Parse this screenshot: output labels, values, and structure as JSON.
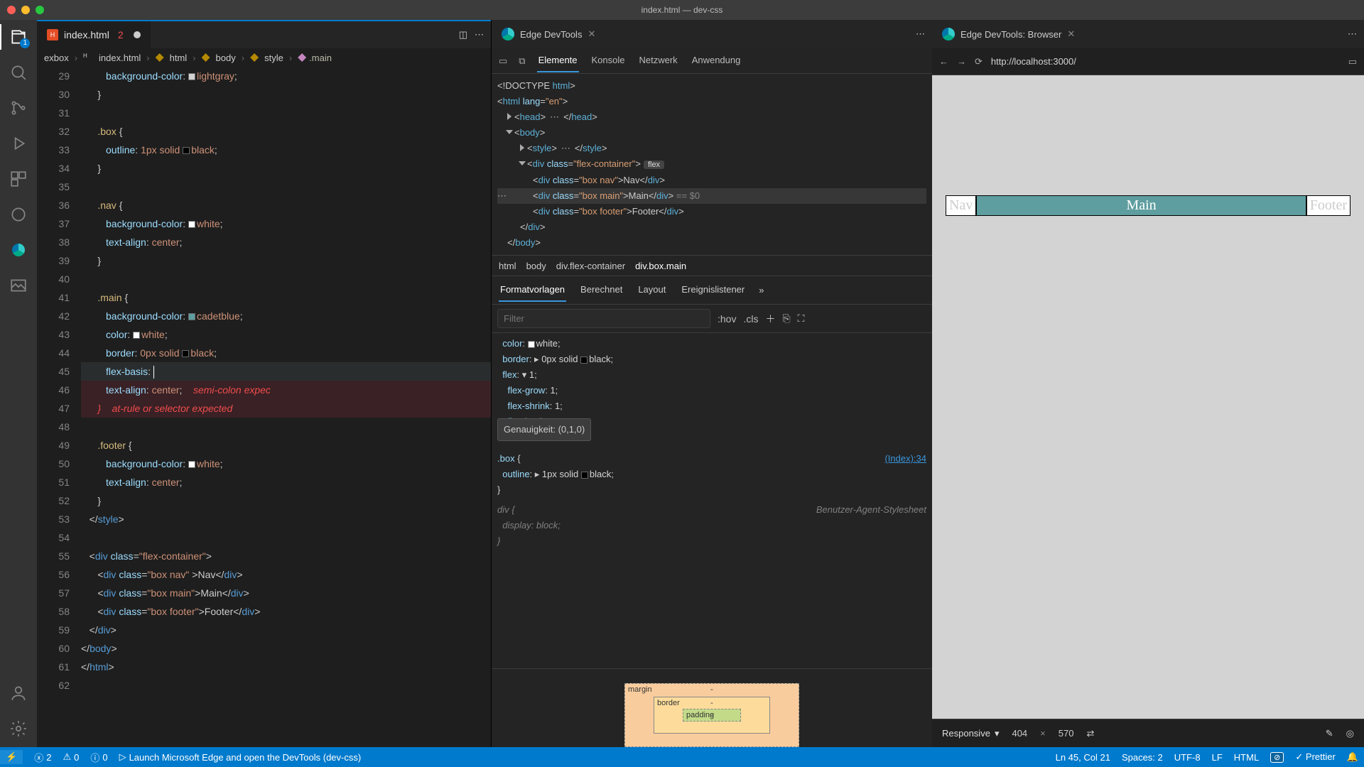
{
  "titlebar": {
    "title": "index.html — dev-css"
  },
  "activity": {
    "badge": "1"
  },
  "editor": {
    "tab": {
      "file": "index.html",
      "errors": "2"
    },
    "breadcrumb": [
      "exbox",
      "index.html",
      "html",
      "body",
      "style",
      ".main"
    ],
    "lines": [
      {
        "n": 29,
        "html": "         <span class='prop'>background-color</span>: <span class='sw' style='background:#d3d3d3'></span><span class='val'>lightgray</span>;"
      },
      {
        "n": 30,
        "html": "      }"
      },
      {
        "n": 31,
        "html": ""
      },
      {
        "n": 32,
        "html": "      <span class='kw'>.box</span> {"
      },
      {
        "n": 33,
        "html": "         <span class='prop'>outline</span>: <span class='val'>1px solid</span> <span class='sw' style='background:#000'></span><span class='val'>black</span>;"
      },
      {
        "n": 34,
        "html": "      }"
      },
      {
        "n": 35,
        "html": ""
      },
      {
        "n": 36,
        "html": "      <span class='kw'>.nav</span> {"
      },
      {
        "n": 37,
        "html": "         <span class='prop'>background-color</span>: <span class='sw' style='background:#fff'></span><span class='val'>white</span>;"
      },
      {
        "n": 38,
        "html": "         <span class='prop'>text-align</span>: <span class='val'>center</span>;"
      },
      {
        "n": 39,
        "html": "      }"
      },
      {
        "n": 40,
        "html": ""
      },
      {
        "n": 41,
        "html": "      <span class='kw'>.main</span> {"
      },
      {
        "n": 42,
        "html": "         <span class='prop'>background-color</span>: <span class='sw' style='background:#5f9ea0'></span><span class='val'>cadetblue</span>;"
      },
      {
        "n": 43,
        "html": "         <span class='prop'>color</span>: <span class='sw' style='background:#fff'></span><span class='val'>white</span>;"
      },
      {
        "n": 44,
        "html": "         <span class='prop'>border</span>: <span class='val'>0px solid</span> <span class='sw' style='background:#000'></span><span class='val'>black</span>;"
      },
      {
        "n": 45,
        "html": "         <span class='prop'>flex-basis</span>: <span class='cursor'></span>",
        "cls": "cur-line"
      },
      {
        "n": 46,
        "html": "         <span class='prop'>text-align</span>: <span class='val'>center</span>;    <span class='err'>semi-colon expec</span>",
        "cls": "err-line"
      },
      {
        "n": 47,
        "html": "      <span class='err'>}</span>    <span class='err'>at-rule or selector expected</span>",
        "cls": "err-line"
      },
      {
        "n": 48,
        "html": ""
      },
      {
        "n": 49,
        "html": "      <span class='kw'>.footer</span> {"
      },
      {
        "n": 50,
        "html": "         <span class='prop'>background-color</span>: <span class='sw' style='background:#fff'></span><span class='val'>white</span>;"
      },
      {
        "n": 51,
        "html": "         <span class='prop'>text-align</span>: <span class='val'>center</span>;"
      },
      {
        "n": 52,
        "html": "      }"
      },
      {
        "n": 53,
        "html": "   &lt;/<span class='tag'>style</span>&gt;"
      },
      {
        "n": 54,
        "html": ""
      },
      {
        "n": 55,
        "html": "   &lt;<span class='tag'>div</span> <span class='cls'>class</span>=<span class='val'>\"flex-container\"</span>&gt;"
      },
      {
        "n": 56,
        "html": "      &lt;<span class='tag'>div</span> <span class='cls'>class</span>=<span class='val'>\"box nav\"</span> &gt;Nav&lt;/<span class='tag'>div</span>&gt;"
      },
      {
        "n": 57,
        "html": "      &lt;<span class='tag'>div</span> <span class='cls'>class</span>=<span class='val'>\"box main\"</span>&gt;Main&lt;/<span class='tag'>div</span>&gt;"
      },
      {
        "n": 58,
        "html": "      &lt;<span class='tag'>div</span> <span class='cls'>class</span>=<span class='val'>\"box footer\"</span>&gt;Footer&lt;/<span class='tag'>div</span>&gt;"
      },
      {
        "n": 59,
        "html": "   &lt;/<span class='tag'>div</span>&gt;"
      },
      {
        "n": 60,
        "html": "&lt;/<span class='tag'>body</span>&gt;"
      },
      {
        "n": 61,
        "html": "&lt;/<span class='tag'>html</span>&gt;"
      },
      {
        "n": 62,
        "html": ""
      }
    ]
  },
  "dev": {
    "tab": "Edge DevTools",
    "topTabs": [
      "Elemente",
      "Konsole",
      "Netzwerk",
      "Anwendung"
    ],
    "crumbs": [
      "html",
      "body",
      "div.flex-container",
      "div.box.main"
    ],
    "styleTabs": [
      "Formatvorlagen",
      "Berechnet",
      "Layout",
      "Ereignislistener"
    ],
    "filterPlaceholder": "Filter",
    "hov": ":hov",
    "cls": ".cls",
    "tooltip": "Genauigkeit: (0,1,0)",
    "src34": "(Index):34",
    "ua": "Benutzer-Agent-Stylesheet",
    "box": {
      "margin": "margin",
      "border": "border",
      "padding": "padding",
      "dash": "-"
    }
  },
  "browser": {
    "tab": "Edge DevTools: Browser",
    "url": "http://localhost:3000/",
    "nav": "Nav",
    "main": "Main",
    "footer": "Footer",
    "mode": "Responsive",
    "w": "404",
    "h": "570"
  },
  "status": {
    "errors": "2",
    "warnings": "0",
    "info": "0",
    "launch": "Launch Microsoft Edge and open the DevTools (dev-css)",
    "pos": "Ln 45, Col 21",
    "spaces": "Spaces: 2",
    "enc": "UTF-8",
    "eol": "LF",
    "lang": "HTML",
    "prettier": "Prettier"
  }
}
